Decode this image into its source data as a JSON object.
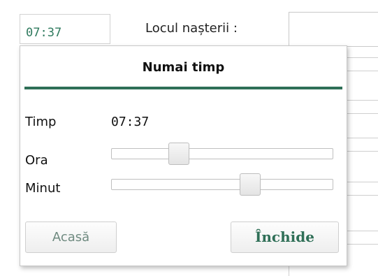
{
  "form": {
    "time_value": "07:37",
    "birthplace_label": "Locul nașterii :",
    "birthplace_value": ""
  },
  "popup": {
    "title": "Numai timp",
    "time_label": "Timp",
    "time_value": "07:37",
    "hour_label": "Ora",
    "minute_label": "Minut",
    "hour": 7,
    "hour_max": 23,
    "minute": 37,
    "minute_max": 59,
    "home_button": "Acasă",
    "close_button": "Închide"
  },
  "colors": {
    "accent": "#2f6f57",
    "time_text": "#2f7a5e"
  }
}
